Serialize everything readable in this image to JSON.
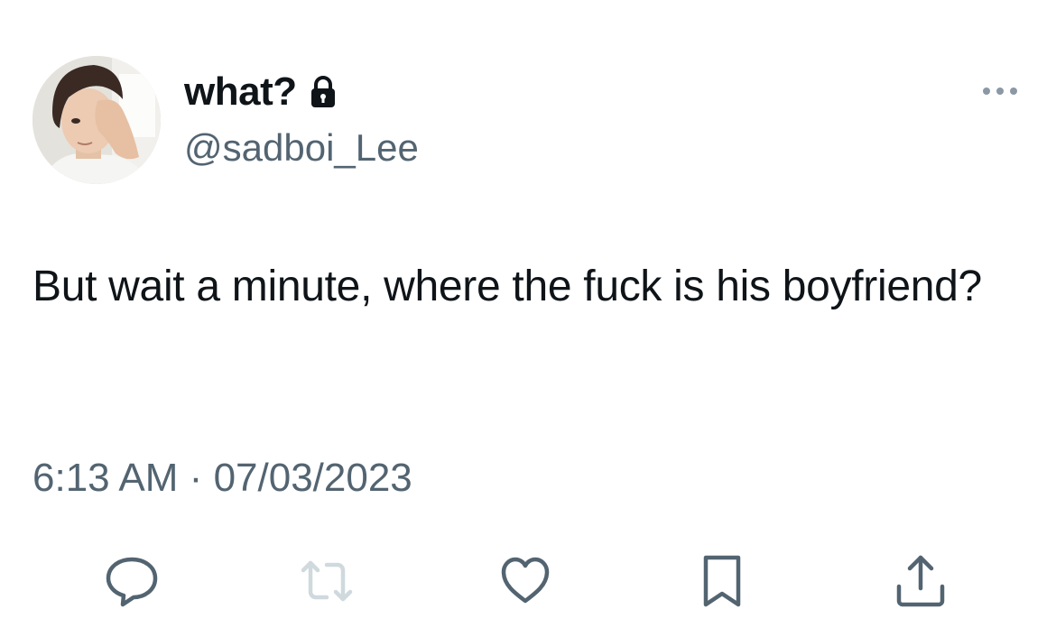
{
  "user": {
    "display_name": "what?",
    "handle": "@sadboi_Lee",
    "protected_icon": "lock-icon",
    "avatar": "profile-photo"
  },
  "tweet": {
    "text": "But wait a minute, where the fuck is his boyfriend?",
    "time": "6:13 AM",
    "separator": "·",
    "date": "07/03/2023"
  },
  "menu": {
    "icon": "more-icon"
  },
  "actions": [
    {
      "icon": "reply-icon"
    },
    {
      "icon": "retweet-icon",
      "state": "disabled"
    },
    {
      "icon": "like-icon"
    },
    {
      "icon": "bookmark-icon"
    },
    {
      "icon": "share-icon"
    }
  ],
  "colors": {
    "text_primary": "#0f1419",
    "text_secondary": "#536471",
    "icon": "#536471",
    "icon_disabled": "#cfd9de",
    "background": "#ffffff"
  }
}
